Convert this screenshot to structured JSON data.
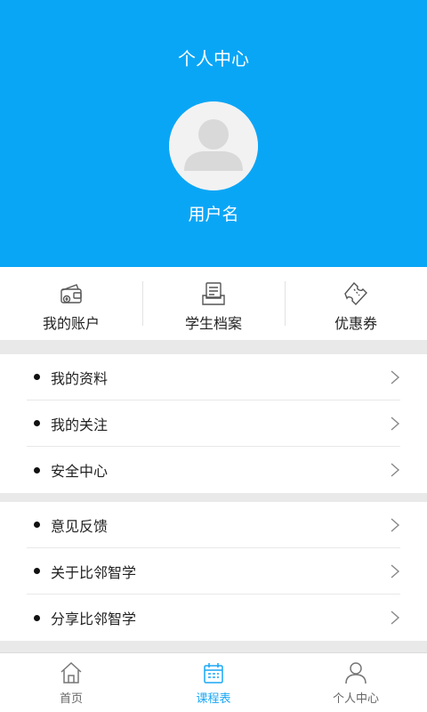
{
  "header": {
    "title": "个人中心",
    "username": "用户名",
    "bg_color": "#0aa6f6"
  },
  "quick_actions": [
    {
      "label": "我的账户",
      "icon": "wallet-icon"
    },
    {
      "label": "学生档案",
      "icon": "archive-icon"
    },
    {
      "label": "优惠券",
      "icon": "coupon-icon"
    }
  ],
  "menu_groups": [
    [
      {
        "label": "我的资料"
      },
      {
        "label": "我的关注"
      },
      {
        "label": "安全中心"
      }
    ],
    [
      {
        "label": "意见反馈"
      },
      {
        "label": "关于比邻智学"
      },
      {
        "label": "分享比邻智学"
      }
    ]
  ],
  "tabbar": {
    "active_color": "#1aa7f5",
    "items": [
      {
        "label": "首页",
        "icon": "home-icon",
        "active": false
      },
      {
        "label": "课程表",
        "icon": "calendar-icon",
        "active": true
      },
      {
        "label": "个人中心",
        "icon": "person-icon",
        "active": false
      }
    ]
  }
}
